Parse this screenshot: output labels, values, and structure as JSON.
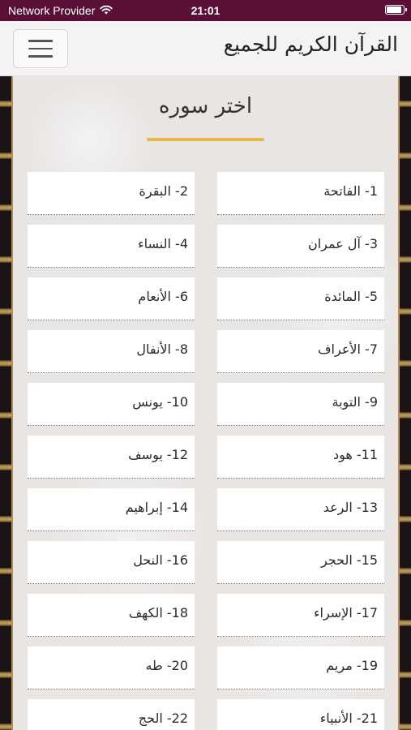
{
  "status_bar": {
    "carrier": "Network Provider",
    "time": "21:01"
  },
  "header": {
    "title": "القرآن الكريم للجميع"
  },
  "main": {
    "title": "اختر سوره",
    "rows": [
      {
        "right": "1- الفاتحة",
        "left": "2- البقرة"
      },
      {
        "right": "3- آل عمران",
        "left": "4- النساء"
      },
      {
        "right": "5- المائدة",
        "left": "6- الأنعام"
      },
      {
        "right": "7- الأعراف",
        "left": "8- الأنفال"
      },
      {
        "right": "9- التوبة",
        "left": "10- يونس"
      },
      {
        "right": "11- هود",
        "left": "12- يوسف"
      },
      {
        "right": "13- الرعد",
        "left": "14- إبراهيم"
      },
      {
        "right": "15- الحجر",
        "left": "16- النحل"
      },
      {
        "right": "17- الإسراء",
        "left": "18- الكهف"
      },
      {
        "right": "19- مريم",
        "left": "20- طه"
      },
      {
        "right": "21- الأنبياء",
        "left": "22- الحج"
      }
    ]
  },
  "colors": {
    "status_bar": "#5a1036",
    "accent": "#e8b848"
  },
  "icons": {
    "menu": "hamburger-icon",
    "wifi": "wifi-icon",
    "battery": "battery-icon"
  }
}
